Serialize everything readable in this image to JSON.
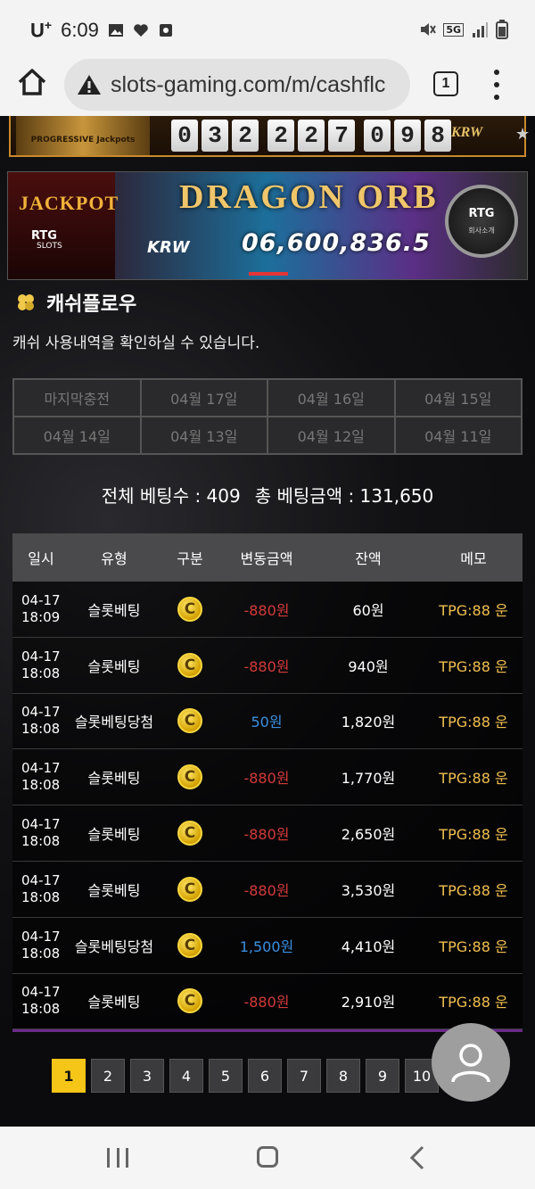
{
  "status_bar": {
    "carrier": "U",
    "carrier_sup": "+",
    "time": "6:09",
    "network": "5G"
  },
  "browser": {
    "url": "slots-gaming.com/m/cashflc",
    "tab_count": "1"
  },
  "jackpot_strip": {
    "logo_text": "PROGRESSIVE Jackpots",
    "digits": [
      "0",
      "3",
      "2",
      "2",
      "2",
      "7",
      "0",
      "9",
      "8"
    ],
    "currency": "KRW"
  },
  "banner": {
    "left_title": "JACKPOT",
    "left_brand": "RTG",
    "left_sub": "SLOTS",
    "title": "DRAGON ORB",
    "currency": "KRW",
    "amount": "06,600,836.5",
    "circle_brand": "RTG",
    "circle_sub": "회사소개"
  },
  "section": {
    "title": "캐쉬플로우",
    "description": "캐쉬 사용내역을 확인하실 수 있습니다."
  },
  "date_tabs": [
    "마지막충전",
    "04월 17일",
    "04월 16일",
    "04월 15일",
    "04월 14일",
    "04월 13일",
    "04월 12일",
    "04월 11일"
  ],
  "totals": {
    "bet_count_label": "전체 베팅수 : 409",
    "bet_amount_label": "총 베팅금액 : 131,650"
  },
  "table": {
    "headers": [
      "일시",
      "유형",
      "구분",
      "변동금액",
      "잔액",
      "메모"
    ],
    "coin_symbol": "C",
    "rows": [
      {
        "date": "04-17",
        "time": "18:09",
        "type": "슬롯베팅",
        "change": "-880원",
        "change_kind": "neg",
        "balance": "60원",
        "memo": "TPG:88 운"
      },
      {
        "date": "04-17",
        "time": "18:08",
        "type": "슬롯베팅",
        "change": "-880원",
        "change_kind": "neg",
        "balance": "940원",
        "memo": "TPG:88 운"
      },
      {
        "date": "04-17",
        "time": "18:08",
        "type": "슬롯베팅당첨",
        "change": "50원",
        "change_kind": "pos",
        "balance": "1,820원",
        "memo": "TPG:88 운"
      },
      {
        "date": "04-17",
        "time": "18:08",
        "type": "슬롯베팅",
        "change": "-880원",
        "change_kind": "neg",
        "balance": "1,770원",
        "memo": "TPG:88 운"
      },
      {
        "date": "04-17",
        "time": "18:08",
        "type": "슬롯베팅",
        "change": "-880원",
        "change_kind": "neg",
        "balance": "2,650원",
        "memo": "TPG:88 운"
      },
      {
        "date": "04-17",
        "time": "18:08",
        "type": "슬롯베팅",
        "change": "-880원",
        "change_kind": "neg",
        "balance": "3,530원",
        "memo": "TPG:88 운"
      },
      {
        "date": "04-17",
        "time": "18:08",
        "type": "슬롯베팅당첨",
        "change": "1,500원",
        "change_kind": "pos",
        "balance": "4,410원",
        "memo": "TPG:88 운"
      },
      {
        "date": "04-17",
        "time": "18:08",
        "type": "슬롯베팅",
        "change": "-880원",
        "change_kind": "neg",
        "balance": "2,910원",
        "memo": "TPG:88 운"
      }
    ]
  },
  "pagination": {
    "pages": [
      "1",
      "2",
      "3",
      "4",
      "5",
      "6",
      "7",
      "8",
      "9",
      "10"
    ],
    "active": "1"
  },
  "colors": {
    "negative": "#d33a3a",
    "positive": "#3b8fe0",
    "memo": "#f0c050",
    "active_page": "#f5c518"
  }
}
